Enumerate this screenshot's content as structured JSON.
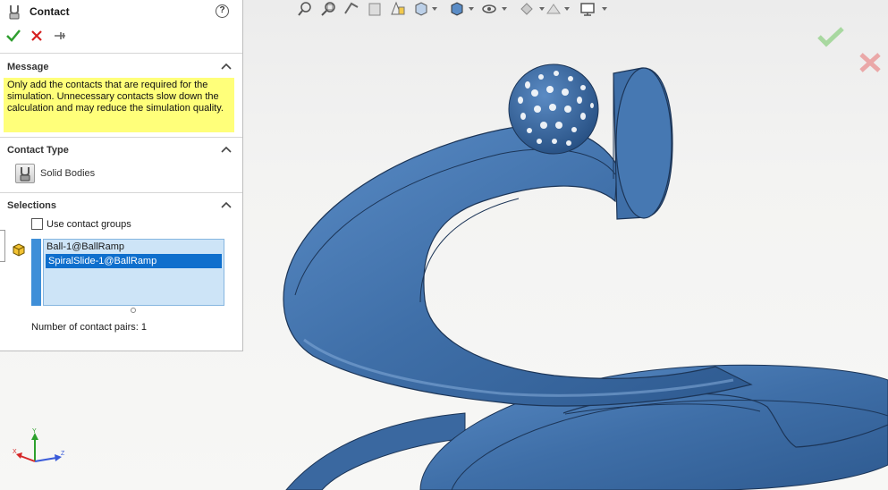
{
  "property_manager": {
    "title": "Contact",
    "help_label": "?",
    "sections": {
      "message": {
        "title": "Message",
        "text": "Only add the contacts that are required for the simulation. Unnecessary contacts slow down the calculation and may reduce the simulation quality."
      },
      "contact_type": {
        "title": "Contact Type",
        "selected_type": "Solid Bodies"
      },
      "selections": {
        "title": "Selections",
        "use_contact_groups_label": "Use contact groups",
        "use_contact_groups_checked": false,
        "items": [
          {
            "label": "Ball-1@BallRamp",
            "selected": false
          },
          {
            "label": "SpiralSlide-1@BallRamp",
            "selected": true
          }
        ],
        "pairs_text": "Number of contact pairs: 1"
      }
    }
  },
  "viewport": {
    "triad_labels": {
      "x": "X",
      "y": "Y",
      "z": "Z"
    },
    "colors": {
      "model": "#3f6fa8",
      "selection_blue": "#0f6fcd",
      "message_yellow": "#ffff7a"
    }
  },
  "icons": [
    "contact-icon",
    "ok-check-icon",
    "cancel-x-icon",
    "pushpin-icon",
    "collapse-chevron-icon",
    "solid-bodies-icon",
    "component-selection-icon",
    "zoom-to-fit-icon",
    "zoom-to-area-icon",
    "previous-view-icon",
    "section-view-icon",
    "dynamic-annotation-icon",
    "view-orientation-icon",
    "display-style-icon",
    "hide-show-items-icon",
    "edit-appearance-icon",
    "apply-scene-icon",
    "view-settings-icon"
  ]
}
